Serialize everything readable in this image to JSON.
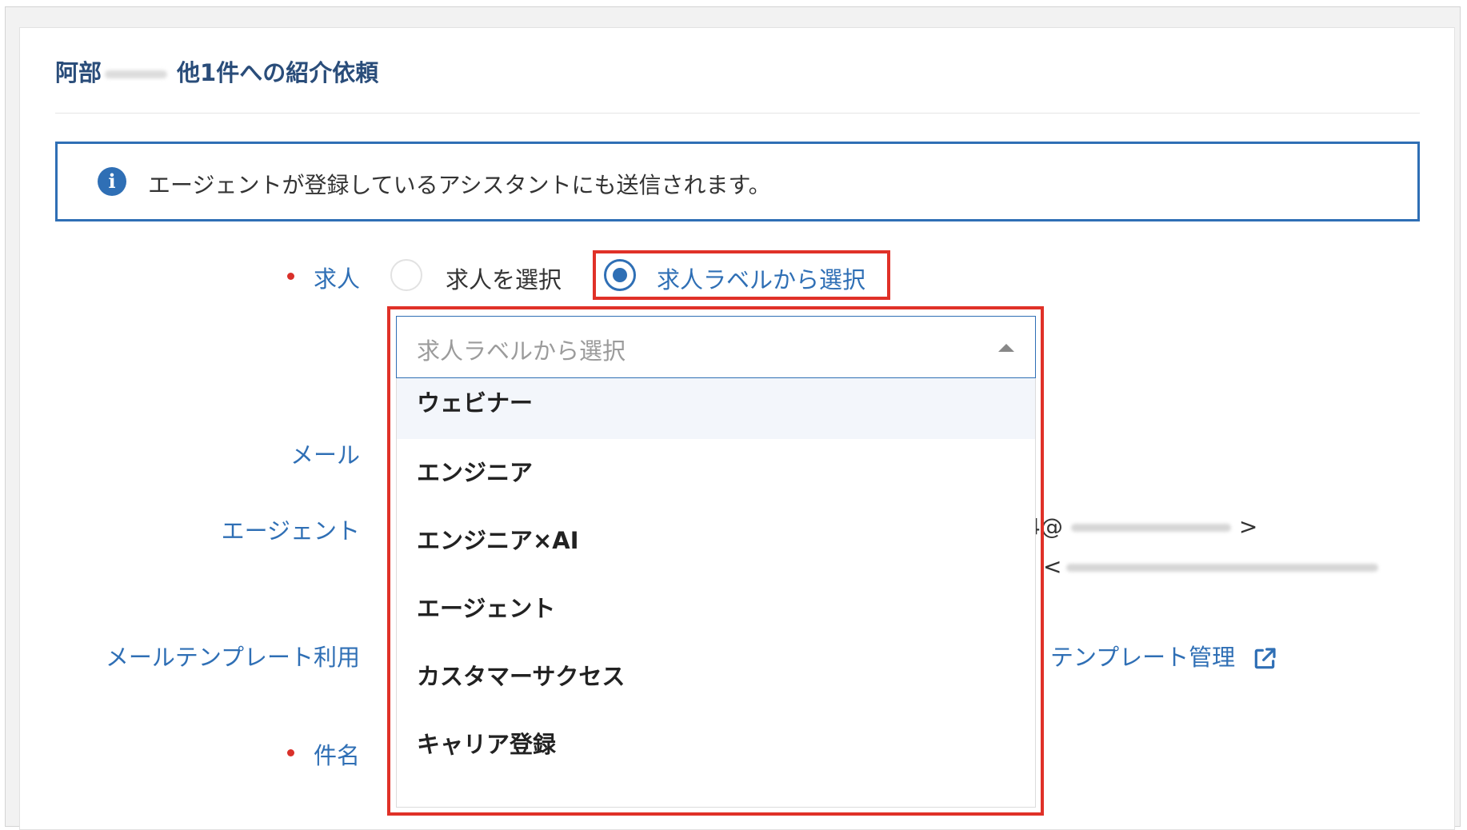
{
  "page": {
    "title_name": "阿部",
    "title_suffix": "他1件への紹介依頼"
  },
  "info": {
    "icon": "info-icon",
    "message": "エージェントが登録しているアシスタントにも送信されます。"
  },
  "form": {
    "job_label": "求人",
    "mail_label": "メール",
    "agent_label": "エージェント",
    "template_label": "メールテンプレート利用",
    "subject_label": "件名"
  },
  "radios": {
    "option1": "求人を選択",
    "option2": "求人ラベルから選択",
    "selected": "求人ラベルから選択"
  },
  "select": {
    "placeholder": "求人ラベルから選択",
    "options": [
      "ウェビナー",
      "エンジニア",
      "エンジニア×AI",
      "エージェント",
      "カスタマーサクセス",
      "キャリア登録"
    ]
  },
  "agent_info": {
    "email_fragment": "4@",
    "gt": ">",
    "lt": "<"
  },
  "template_link": {
    "label": "テンプレート管理",
    "icon": "external-link-icon"
  },
  "colors": {
    "accent": "#2f6fb5",
    "highlight": "#e03128",
    "required": "#d9302a",
    "title": "#2a4d7a"
  }
}
